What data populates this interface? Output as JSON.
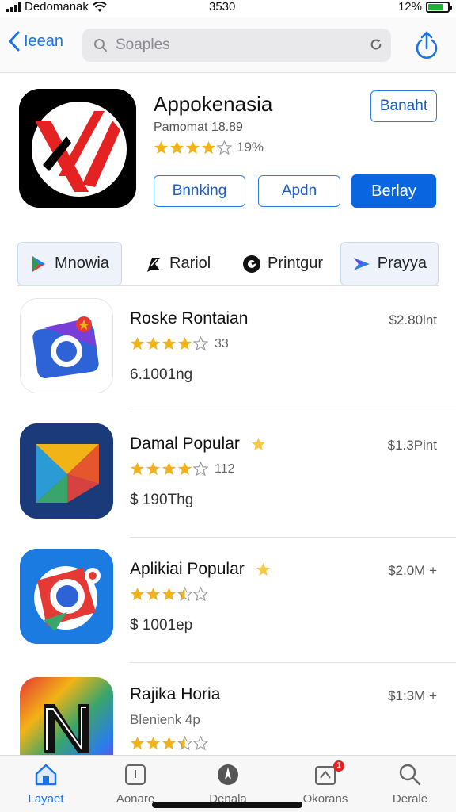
{
  "status_bar": {
    "carrier": "Dedomanak",
    "time": "3530",
    "battery": "12%"
  },
  "nav": {
    "back_label": "Ieean",
    "search_placeholder": "Soaples"
  },
  "app": {
    "title": "Appokenasia",
    "subtitle": "Pamomat 18.89",
    "rating_value": 4,
    "rating_count": "19%",
    "top_button": "Banaht",
    "buttons": [
      "Bnnking",
      "Apdn",
      "Berlay"
    ]
  },
  "tabs": [
    {
      "label": "Mnowia",
      "icon": "play-triangle-icon"
    },
    {
      "label": "Rariol",
      "icon": "flag-icon"
    },
    {
      "label": "Printgur",
      "icon": "record-icon"
    },
    {
      "label": "Prayya",
      "icon": "arrow-chevron-icon"
    }
  ],
  "list": [
    {
      "name": "Roske Rontaian",
      "rating": 4,
      "rating_count": "33",
      "meta": "6.1001ng",
      "price": "$2.80lnt",
      "icon": "camera-icon"
    },
    {
      "name": "Damal Popular",
      "rating": 4,
      "rating_count": "112",
      "meta": "$ 190Thg",
      "price": "$1.3Pint",
      "icon": "kite-icon"
    },
    {
      "name": "Aplikiai Popular",
      "rating": 3.5,
      "rating_count": "",
      "meta": "$ 1001ep",
      "price": "$2.0M +",
      "icon": "lens-icon"
    },
    {
      "name": "Rajika Horia",
      "rating": 3.5,
      "developer": "Blenienk 4p",
      "price": "$1:3M +",
      "icon": "n-logo-icon"
    }
  ],
  "tabbar": [
    {
      "label": "Layaet",
      "icon": "home-icon",
      "active": true
    },
    {
      "label": "Aonare",
      "icon": "apps-icon",
      "active": false
    },
    {
      "label": "Denala",
      "icon": "compass-icon",
      "active": false
    },
    {
      "label": "Okorans",
      "icon": "updates-icon",
      "active": false,
      "badge": "1"
    },
    {
      "label": "Derale",
      "icon": "search-icon",
      "active": false
    }
  ],
  "colors": {
    "accent": "#1a73e8",
    "primary_button": "#0a66e0",
    "star": "#f2b316"
  }
}
